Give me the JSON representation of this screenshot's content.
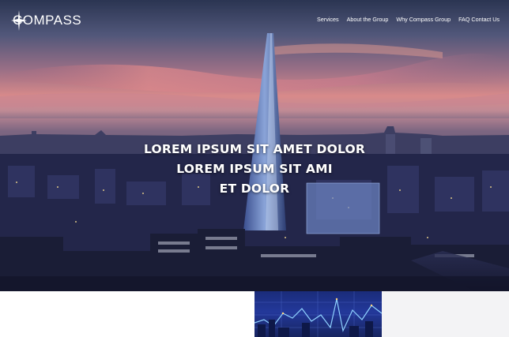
{
  "brand": {
    "name": "COMPASS",
    "logo_icon": "compass-star-icon"
  },
  "nav": {
    "items": [
      {
        "label": "Services"
      },
      {
        "label": "About the Group"
      },
      {
        "label": "Why Compass Group"
      },
      {
        "label": "FAQ Contact Us"
      }
    ]
  },
  "hero": {
    "headline_lines": [
      "LOREM IPSUM SIT AMET DOLOR",
      "LOREM IPSUM SIT AMI",
      "ET DOLOR"
    ]
  },
  "colors": {
    "sky_top": "#2b3552",
    "sunset": "#d88a8a",
    "city": "#1b1e3a",
    "tile_blue": "#23389a",
    "tile_gray": "#f3f3f5"
  }
}
